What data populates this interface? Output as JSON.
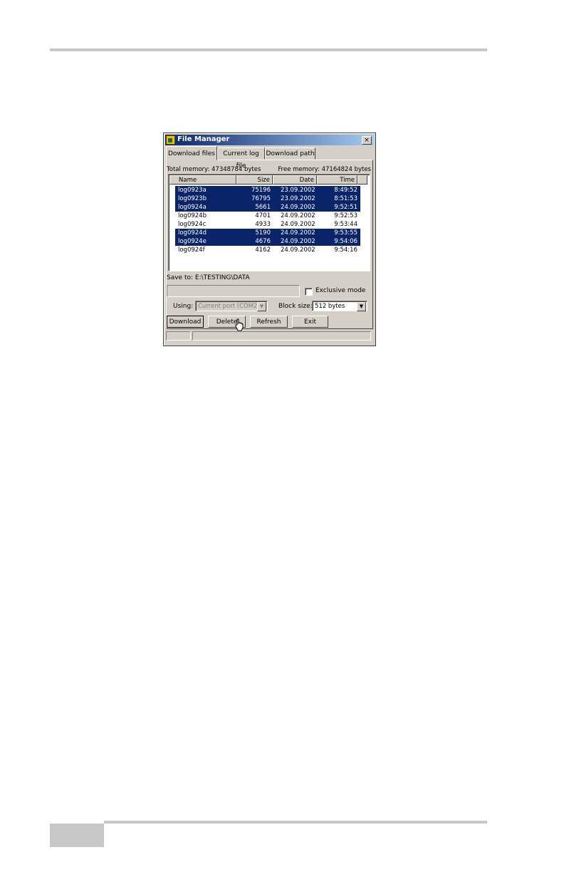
{
  "window": {
    "title": "File Manager",
    "close": "×"
  },
  "tabs": [
    {
      "label": "Download files",
      "active": true
    },
    {
      "label": "Current log file",
      "active": false
    },
    {
      "label": "Download path",
      "active": false
    }
  ],
  "memory": {
    "total": "Total memory: 47348784 bytes",
    "free": "Free memory: 47164824 bytes"
  },
  "file_list": {
    "columns": [
      "Name",
      "Size",
      "Date",
      "Time"
    ],
    "rows": [
      {
        "name": "log0923a",
        "size": "75196",
        "date": "23.09.2002",
        "time": "8:49:52",
        "selected": true
      },
      {
        "name": "log0923b",
        "size": "76795",
        "date": "23.09.2002",
        "time": "8:51:53",
        "selected": true
      },
      {
        "name": "log0924a",
        "size": "5661",
        "date": "24.09.2002",
        "time": "9:52:51",
        "selected": true
      },
      {
        "name": "log0924b",
        "size": "4701",
        "date": "24.09.2002",
        "time": "9:52:53",
        "selected": false
      },
      {
        "name": "log0924c",
        "size": "4933",
        "date": "24.09.2002",
        "time": "9:53:44",
        "selected": false
      },
      {
        "name": "log0924d",
        "size": "5190",
        "date": "24.09.2002",
        "time": "9:53:55",
        "selected": true
      },
      {
        "name": "log0924e",
        "size": "4676",
        "date": "24.09.2002",
        "time": "9:54:06",
        "selected": true
      },
      {
        "name": "log0924f",
        "size": "4162",
        "date": "24.09.2002",
        "time": "9:54:16",
        "selected": false
      }
    ]
  },
  "save_to": "Save to: E:\\TESTING\\DATA",
  "exclusive_mode": {
    "label": "Exclusive mode",
    "checked": false
  },
  "using": {
    "label": "Using:",
    "value": "Current port (COM2)"
  },
  "block_size": {
    "label": "Block size:",
    "value": "512 bytes"
  },
  "buttons": {
    "download": "Download",
    "delete": "Delete",
    "refresh": "Refresh",
    "exit": "Exit"
  },
  "colors": {
    "selection": "#0a246a",
    "face": "#d4d0c8"
  }
}
